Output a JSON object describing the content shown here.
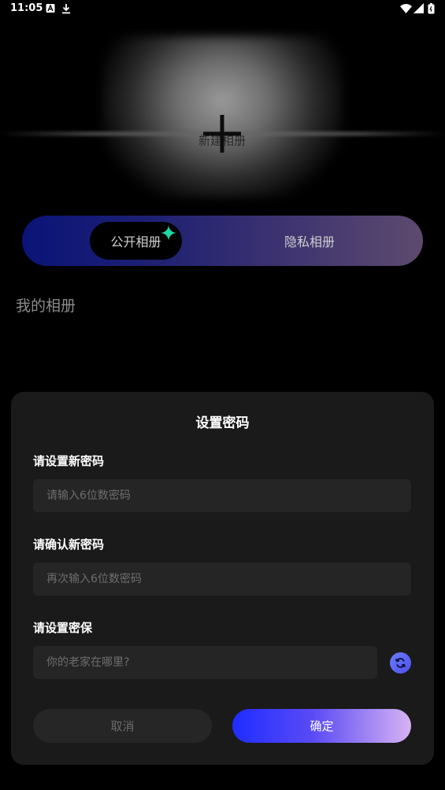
{
  "status_bar": {
    "time": "11:05",
    "icons_left": [
      "text-a-icon",
      "download-icon"
    ],
    "icons_right": [
      "wifi-icon",
      "signal-icon",
      "battery-icon"
    ]
  },
  "hero": {
    "new_album_label": "新建相册",
    "plus_icon": "plus-icon"
  },
  "tabs": {
    "public_label": "公开相册",
    "private_label": "隐私相册",
    "active": "public",
    "sparkle_color": "#1fd6a4"
  },
  "section": {
    "title": "我的相册"
  },
  "dialog": {
    "title": "设置密码",
    "new_password": {
      "label": "请设置新密码",
      "placeholder": "请输入6位数密码",
      "value": ""
    },
    "confirm_password": {
      "label": "请确认新密码",
      "placeholder": "再次输入6位数密码",
      "value": ""
    },
    "security_question": {
      "label": "请设置密保",
      "placeholder": "你的老家在哪里?",
      "value": "",
      "refresh_icon": "refresh-icon"
    },
    "cancel_label": "取消",
    "confirm_label": "确定"
  },
  "colors": {
    "background": "#000000",
    "dialog": "#1a1a1a",
    "input": "#252525",
    "accent_start": "#1f2dff",
    "accent_end": "#d7b2f3"
  }
}
